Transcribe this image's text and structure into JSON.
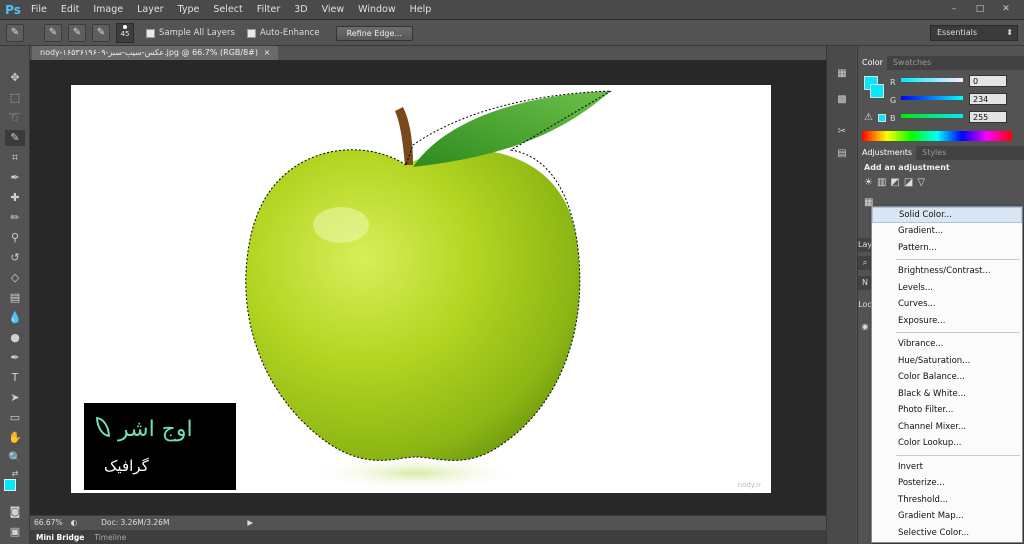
{
  "app": {
    "logo": "Ps"
  },
  "menubar": [
    "File",
    "Edit",
    "Image",
    "Layer",
    "Type",
    "Select",
    "Filter",
    "3D",
    "View",
    "Window",
    "Help"
  ],
  "window_controls": [
    "–",
    "□",
    "✕"
  ],
  "options": {
    "brush_size": "45",
    "sample_all_layers": "Sample All Layers",
    "auto_enhance": "Auto-Enhance",
    "refine_edge": "Refine Edge...",
    "workspace": "Essentials"
  },
  "document": {
    "tab_title": "nody-۱۶۵۳۶۱۹۶۰۹-عکس-سیب-سبز.jpg @ 66.7% (RGB/8#)",
    "close": "×"
  },
  "status": {
    "zoom": "66.67%",
    "doc": "Doc: 3.26M/3.26M"
  },
  "bottom_tabs": [
    "Mini Bridge",
    "Timeline"
  ],
  "logo": {
    "brand": "اوج اشر",
    "sub": "گرافیک"
  },
  "watermark": "nody.ir",
  "color_panel": {
    "tabs": [
      "Color",
      "Swatches"
    ],
    "r_label": "R",
    "g_label": "G",
    "b_label": "B",
    "r": "0",
    "g": "234",
    "b": "255",
    "swatch": "#00eaff"
  },
  "adjustments_panel": {
    "tabs": [
      "Adjustments",
      "Styles"
    ],
    "title": "Add an adjustment"
  },
  "layers_stub": [
    "Lay",
    "N",
    "Loc"
  ],
  "adjustment_menu": {
    "group1": [
      "Solid Color...",
      "Gradient...",
      "Pattern..."
    ],
    "group2": [
      "Brightness/Contrast...",
      "Levels...",
      "Curves...",
      "Exposure..."
    ],
    "group3": [
      "Vibrance...",
      "Hue/Saturation...",
      "Color Balance...",
      "Black & White...",
      "Photo Filter...",
      "Channel Mixer...",
      "Color Lookup..."
    ],
    "group4": [
      "Invert",
      "Posterize...",
      "Threshold...",
      "Gradient Map...",
      "Selective Color..."
    ]
  }
}
